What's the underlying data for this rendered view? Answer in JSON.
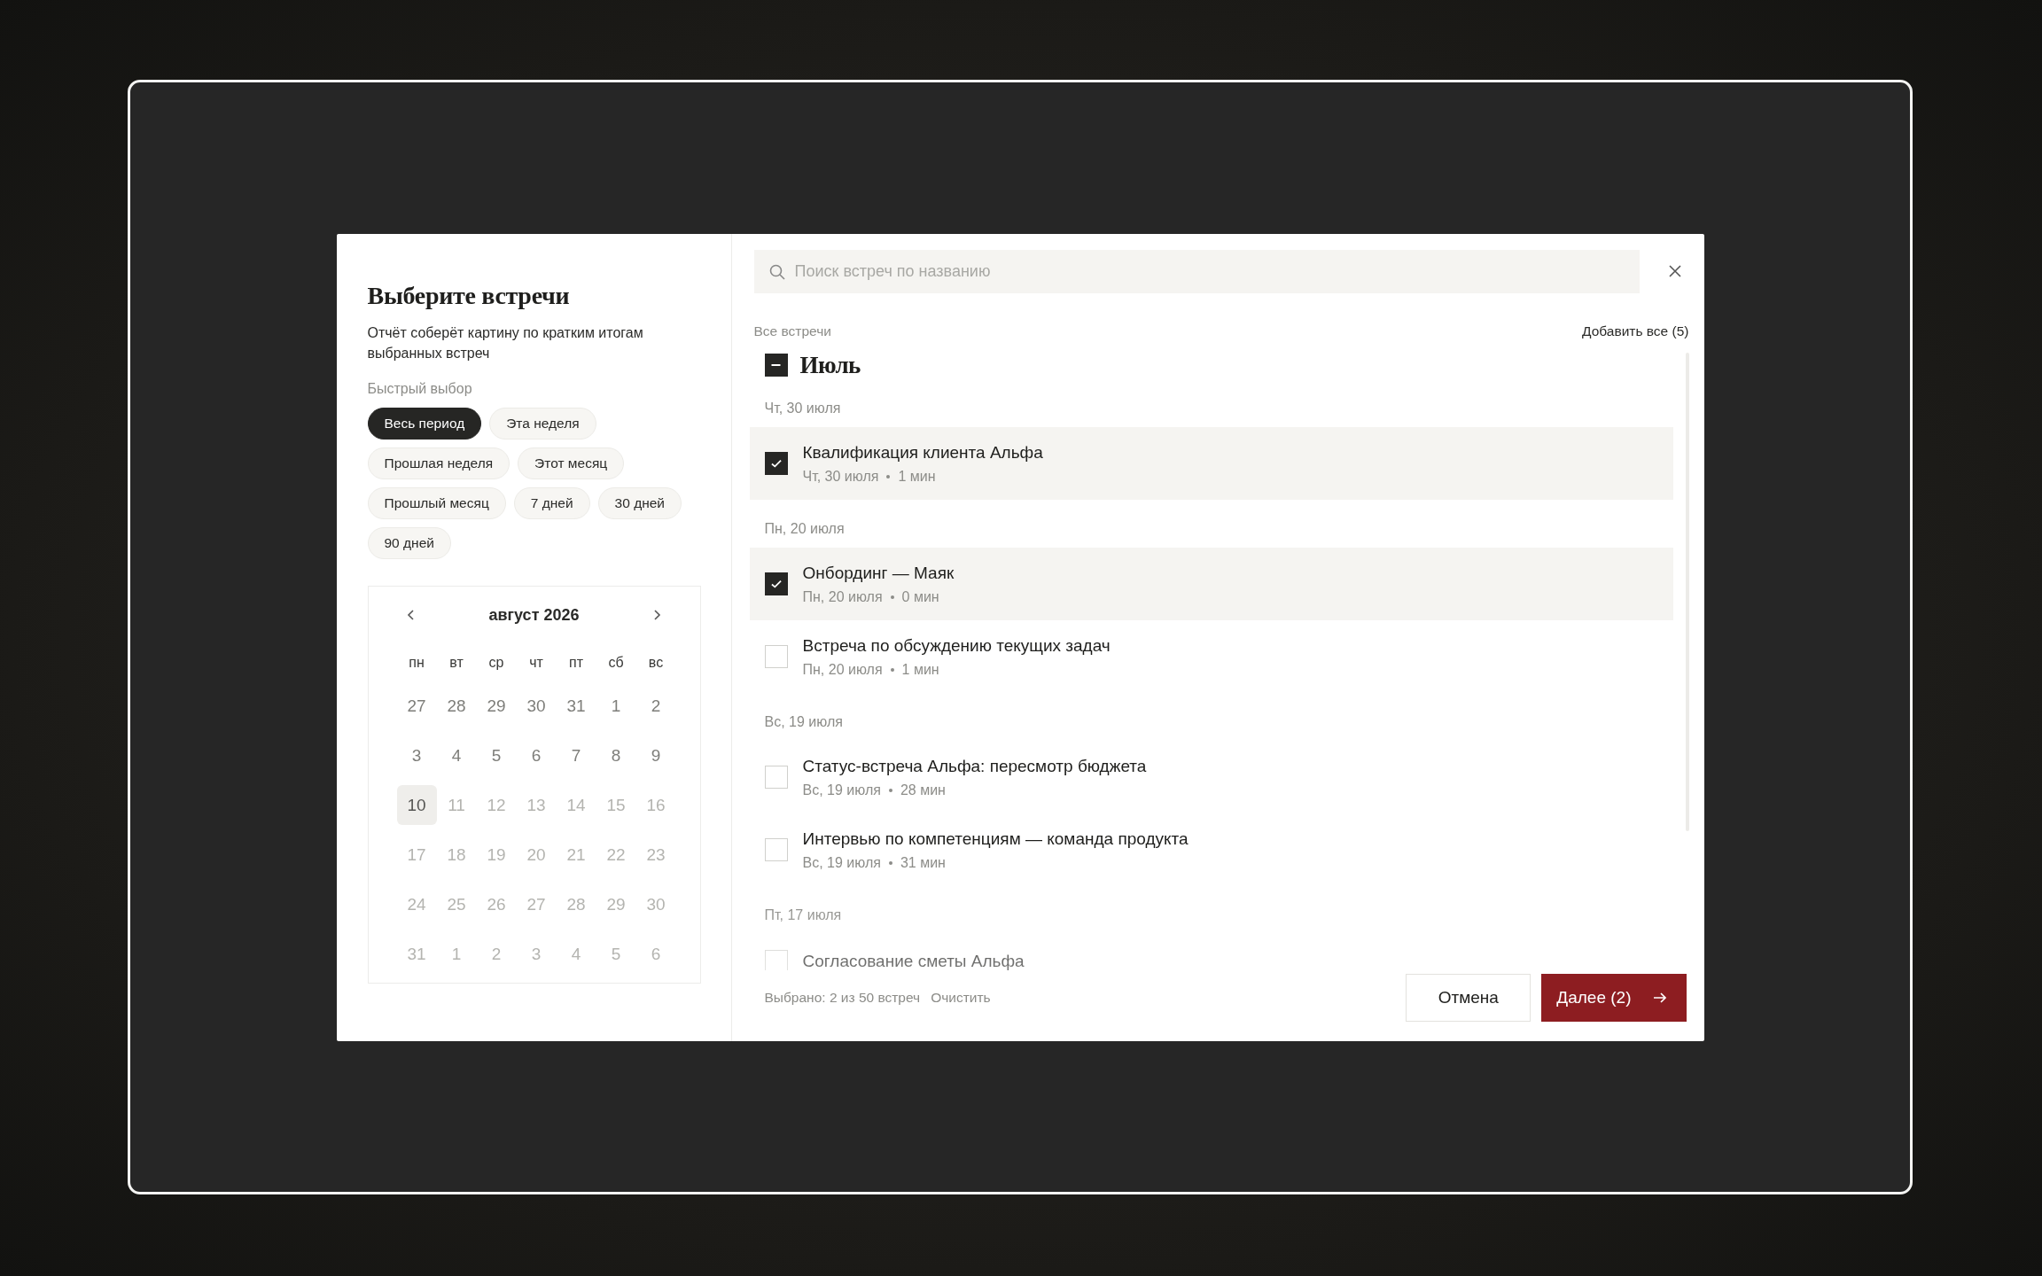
{
  "dialog": {
    "title": "Выберите встречи",
    "subtitle": "Отчёт соберёт картину по кратким итогам выбранных встреч",
    "quick_label": "Быстрый выбор",
    "quick_ranges": [
      {
        "label": "Весь период",
        "selected": true
      },
      {
        "label": "Эта неделя",
        "selected": false
      },
      {
        "label": "Прошлая неделя",
        "selected": false
      },
      {
        "label": "Этот месяц",
        "selected": false
      },
      {
        "label": "Прошлый месяц",
        "selected": false
      },
      {
        "label": "7 дней",
        "selected": false
      },
      {
        "label": "30 дней",
        "selected": false
      },
      {
        "label": "90 дней",
        "selected": false
      }
    ],
    "calendar": {
      "month": "август 2026",
      "weekdays": [
        "пн",
        "вт",
        "ср",
        "чт",
        "пт",
        "сб",
        "вс"
      ],
      "days": [
        {
          "label": "27",
          "disabled": false,
          "selected": false
        },
        {
          "label": "28",
          "disabled": false,
          "selected": false
        },
        {
          "label": "29",
          "disabled": false,
          "selected": false
        },
        {
          "label": "30",
          "disabled": false,
          "selected": false
        },
        {
          "label": "31",
          "disabled": false,
          "selected": false
        },
        {
          "label": "1",
          "disabled": false,
          "selected": false
        },
        {
          "label": "2",
          "disabled": false,
          "selected": false
        },
        {
          "label": "3",
          "disabled": false,
          "selected": false
        },
        {
          "label": "4",
          "disabled": false,
          "selected": false
        },
        {
          "label": "5",
          "disabled": false,
          "selected": false
        },
        {
          "label": "6",
          "disabled": false,
          "selected": false
        },
        {
          "label": "7",
          "disabled": false,
          "selected": false
        },
        {
          "label": "8",
          "disabled": false,
          "selected": false
        },
        {
          "label": "9",
          "disabled": false,
          "selected": false
        },
        {
          "label": "10",
          "disabled": false,
          "selected": true
        },
        {
          "label": "11",
          "disabled": true,
          "selected": false
        },
        {
          "label": "12",
          "disabled": true,
          "selected": false
        },
        {
          "label": "13",
          "disabled": true,
          "selected": false
        },
        {
          "label": "14",
          "disabled": true,
          "selected": false
        },
        {
          "label": "15",
          "disabled": true,
          "selected": false
        },
        {
          "label": "16",
          "disabled": true,
          "selected": false
        },
        {
          "label": "17",
          "disabled": true,
          "selected": false
        },
        {
          "label": "18",
          "disabled": true,
          "selected": false
        },
        {
          "label": "19",
          "disabled": true,
          "selected": false
        },
        {
          "label": "20",
          "disabled": true,
          "selected": false
        },
        {
          "label": "21",
          "disabled": true,
          "selected": false
        },
        {
          "label": "22",
          "disabled": true,
          "selected": false
        },
        {
          "label": "23",
          "disabled": true,
          "selected": false
        },
        {
          "label": "24",
          "disabled": true,
          "selected": false
        },
        {
          "label": "25",
          "disabled": true,
          "selected": false
        },
        {
          "label": "26",
          "disabled": true,
          "selected": false
        },
        {
          "label": "27",
          "disabled": true,
          "selected": false
        },
        {
          "label": "28",
          "disabled": true,
          "selected": false
        },
        {
          "label": "29",
          "disabled": true,
          "selected": false
        },
        {
          "label": "30",
          "disabled": true,
          "selected": false
        },
        {
          "label": "31",
          "disabled": true,
          "selected": false
        },
        {
          "label": "1",
          "disabled": true,
          "selected": false
        },
        {
          "label": "2",
          "disabled": true,
          "selected": false
        },
        {
          "label": "3",
          "disabled": true,
          "selected": false
        },
        {
          "label": "4",
          "disabled": true,
          "selected": false
        },
        {
          "label": "5",
          "disabled": true,
          "selected": false
        },
        {
          "label": "6",
          "disabled": true,
          "selected": false
        }
      ]
    },
    "search": {
      "placeholder": "Поиск встреч по названию"
    },
    "list_label": "Все встречи",
    "add_all": "Добавить все (5)",
    "month_group": {
      "label": "Июль",
      "indeterminate": true,
      "days": [
        {
          "date": "Чт, 30 июля",
          "meetings": [
            {
              "title": "Квалификация клиента Альфа",
              "date": "Чт, 30 июля",
              "duration": "1 мин",
              "checked": true
            }
          ]
        },
        {
          "date": "Пн, 20 июля",
          "meetings": [
            {
              "title": "Онбординг — Маяк",
              "date": "Пн, 20 июля",
              "duration": "0 мин",
              "checked": true
            },
            {
              "title": "Встреча по обсуждению текущих задач",
              "date": "Пн, 20 июля",
              "duration": "1 мин",
              "checked": false
            }
          ]
        },
        {
          "date": "Вс, 19 июля",
          "meetings": [
            {
              "title": "Статус-встреча Альфа: пересмотр бюджета",
              "date": "Вс, 19 июля",
              "duration": "28 мин",
              "checked": false
            },
            {
              "title": "Интервью по компетенциям — команда продукта",
              "date": "Вс, 19 июля",
              "duration": "31 мин",
              "checked": false
            }
          ]
        },
        {
          "date": "Пт, 17 июля",
          "meetings": [
            {
              "title": "Согласование сметы Альфа",
              "checked": false
            }
          ]
        }
      ]
    },
    "footer": {
      "summary": "Выбрано: 2 из 50 встреч",
      "clear": "Очистить",
      "cancel": "Отмена",
      "next": "Далее (2)"
    }
  }
}
